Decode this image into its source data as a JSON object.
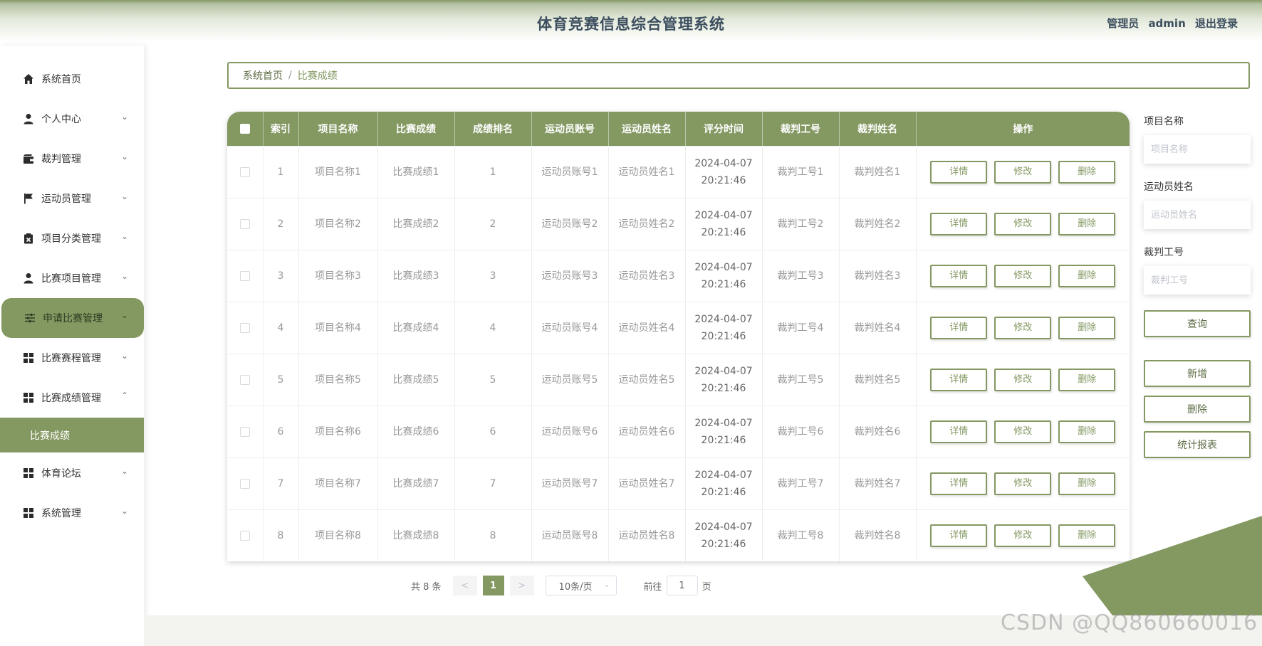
{
  "header": {
    "title": "体育竞赛信息综合管理系统",
    "role": "管理员",
    "username": "admin",
    "logout_label": "退出登录"
  },
  "sidebar": {
    "items": [
      {
        "label": "系统首页",
        "icon": "home-icon",
        "chevron": ""
      },
      {
        "label": "个人中心",
        "icon": "user-icon",
        "chevron": "⌄"
      },
      {
        "label": "裁判管理",
        "icon": "wallet-icon",
        "chevron": "⌄"
      },
      {
        "label": "运动员管理",
        "icon": "flag-icon",
        "chevron": "⌄"
      },
      {
        "label": "项目分类管理",
        "icon": "clipboard-icon",
        "chevron": "⌄"
      },
      {
        "label": "比赛项目管理",
        "icon": "person-icon",
        "chevron": "⌄"
      },
      {
        "label": "申请比赛管理",
        "icon": "sliders-icon",
        "chevron": "⌄"
      },
      {
        "label": "比赛赛程管理",
        "icon": "grid-icon",
        "chevron": "⌄"
      },
      {
        "label": "比赛成绩管理",
        "icon": "grid-icon",
        "chevron": "⌃"
      },
      {
        "label": "体育论坛",
        "icon": "grid-icon",
        "chevron": "⌄"
      },
      {
        "label": "系统管理",
        "icon": "grid-icon",
        "chevron": "⌄"
      }
    ],
    "submenu_label": "比赛成绩",
    "active_index": 6
  },
  "breadcrumb": {
    "home": "系统首页",
    "separator": "/",
    "current": "比赛成绩"
  },
  "table": {
    "columns": [
      "索引",
      "项目名称",
      "比赛成绩",
      "成绩排名",
      "运动员账号",
      "运动员姓名",
      "评分时间",
      "裁判工号",
      "裁判姓名",
      "操作"
    ],
    "rows": [
      {
        "index": "1",
        "project": "项目名称1",
        "score": "比赛成绩1",
        "rank": "1",
        "athlete_account": "运动员账号1",
        "athlete_name": "运动员姓名1",
        "date": "2024-04-07",
        "time": "20:21:46",
        "judge_no": "裁判工号1",
        "judge_name": "裁判姓名1"
      },
      {
        "index": "2",
        "project": "项目名称2",
        "score": "比赛成绩2",
        "rank": "2",
        "athlete_account": "运动员账号2",
        "athlete_name": "运动员姓名2",
        "date": "2024-04-07",
        "time": "20:21:46",
        "judge_no": "裁判工号2",
        "judge_name": "裁判姓名2"
      },
      {
        "index": "3",
        "project": "项目名称3",
        "score": "比赛成绩3",
        "rank": "3",
        "athlete_account": "运动员账号3",
        "athlete_name": "运动员姓名3",
        "date": "2024-04-07",
        "time": "20:21:46",
        "judge_no": "裁判工号3",
        "judge_name": "裁判姓名3"
      },
      {
        "index": "4",
        "project": "项目名称4",
        "score": "比赛成绩4",
        "rank": "4",
        "athlete_account": "运动员账号4",
        "athlete_name": "运动员姓名4",
        "date": "2024-04-07",
        "time": "20:21:46",
        "judge_no": "裁判工号4",
        "judge_name": "裁判姓名4"
      },
      {
        "index": "5",
        "project": "项目名称5",
        "score": "比赛成绩5",
        "rank": "5",
        "athlete_account": "运动员账号5",
        "athlete_name": "运动员姓名5",
        "date": "2024-04-07",
        "time": "20:21:46",
        "judge_no": "裁判工号5",
        "judge_name": "裁判姓名5"
      },
      {
        "index": "6",
        "project": "项目名称6",
        "score": "比赛成绩6",
        "rank": "6",
        "athlete_account": "运动员账号6",
        "athlete_name": "运动员姓名6",
        "date": "2024-04-07",
        "time": "20:21:46",
        "judge_no": "裁判工号6",
        "judge_name": "裁判姓名6"
      },
      {
        "index": "7",
        "project": "项目名称7",
        "score": "比赛成绩7",
        "rank": "7",
        "athlete_account": "运动员账号7",
        "athlete_name": "运动员姓名7",
        "date": "2024-04-07",
        "time": "20:21:46",
        "judge_no": "裁判工号7",
        "judge_name": "裁判姓名7"
      },
      {
        "index": "8",
        "project": "项目名称8",
        "score": "比赛成绩8",
        "rank": "8",
        "athlete_account": "运动员账号8",
        "athlete_name": "运动员姓名8",
        "date": "2024-04-07",
        "time": "20:21:46",
        "judge_no": "裁判工号8",
        "judge_name": "裁判姓名8"
      }
    ],
    "actions": {
      "detail": "详情",
      "edit": "修改",
      "delete": "删除"
    }
  },
  "pagination": {
    "total_label": "共 8 条",
    "prev": "<",
    "current_page": "1",
    "next": ">",
    "page_size": "10条/页",
    "goto_label": "前往",
    "goto_value": "1",
    "page_suffix": "页"
  },
  "search": {
    "project_label": "项目名称",
    "project_placeholder": "项目名称",
    "athlete_label": "运动员姓名",
    "athlete_placeholder": "运动员姓名",
    "judge_label": "裁判工号",
    "judge_placeholder": "裁判工号",
    "query_button": "查询",
    "add_button": "新增",
    "delete_button": "删除",
    "report_button": "统计报表"
  },
  "watermark": "CSDN @QQ860660016",
  "colors": {
    "accent": "#849862",
    "header_text": "#3d4f5f",
    "muted_text": "#999999"
  }
}
